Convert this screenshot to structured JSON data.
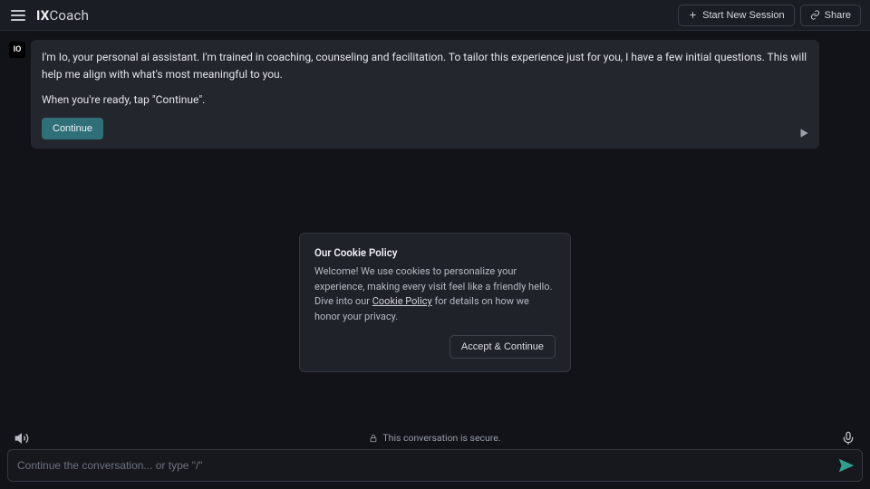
{
  "header": {
    "logo_bold": "IX",
    "logo_light": "Coach",
    "start_new_session": "Start New Session",
    "share": "Share"
  },
  "chat": {
    "avatar_initials": "IO",
    "paragraph1": "I'm Io, your personal ai assistant. I'm trained in coaching, counseling and facilitation. To tailor this experience just for you, I have a few initial questions. This will help me align with what's most meaningful to you.",
    "paragraph2": "When you're ready, tap \"Continue\".",
    "continue_label": "Continue"
  },
  "cookie": {
    "title": "Our Cookie Policy",
    "body_pre": "Welcome! We use cookies to personalize your experience, making every visit feel like a friendly hello. Dive into our ",
    "link_text": "Cookie Policy",
    "body_post": " for details on how we honor your privacy.",
    "accept_label": "Accept & Continue"
  },
  "footer": {
    "secure_text": "This conversation is secure.",
    "input_placeholder": "Continue the conversation... or type \"/\""
  },
  "colors": {
    "accent_teal": "#2f9e8f",
    "bubble_button": "#2f6f77"
  }
}
